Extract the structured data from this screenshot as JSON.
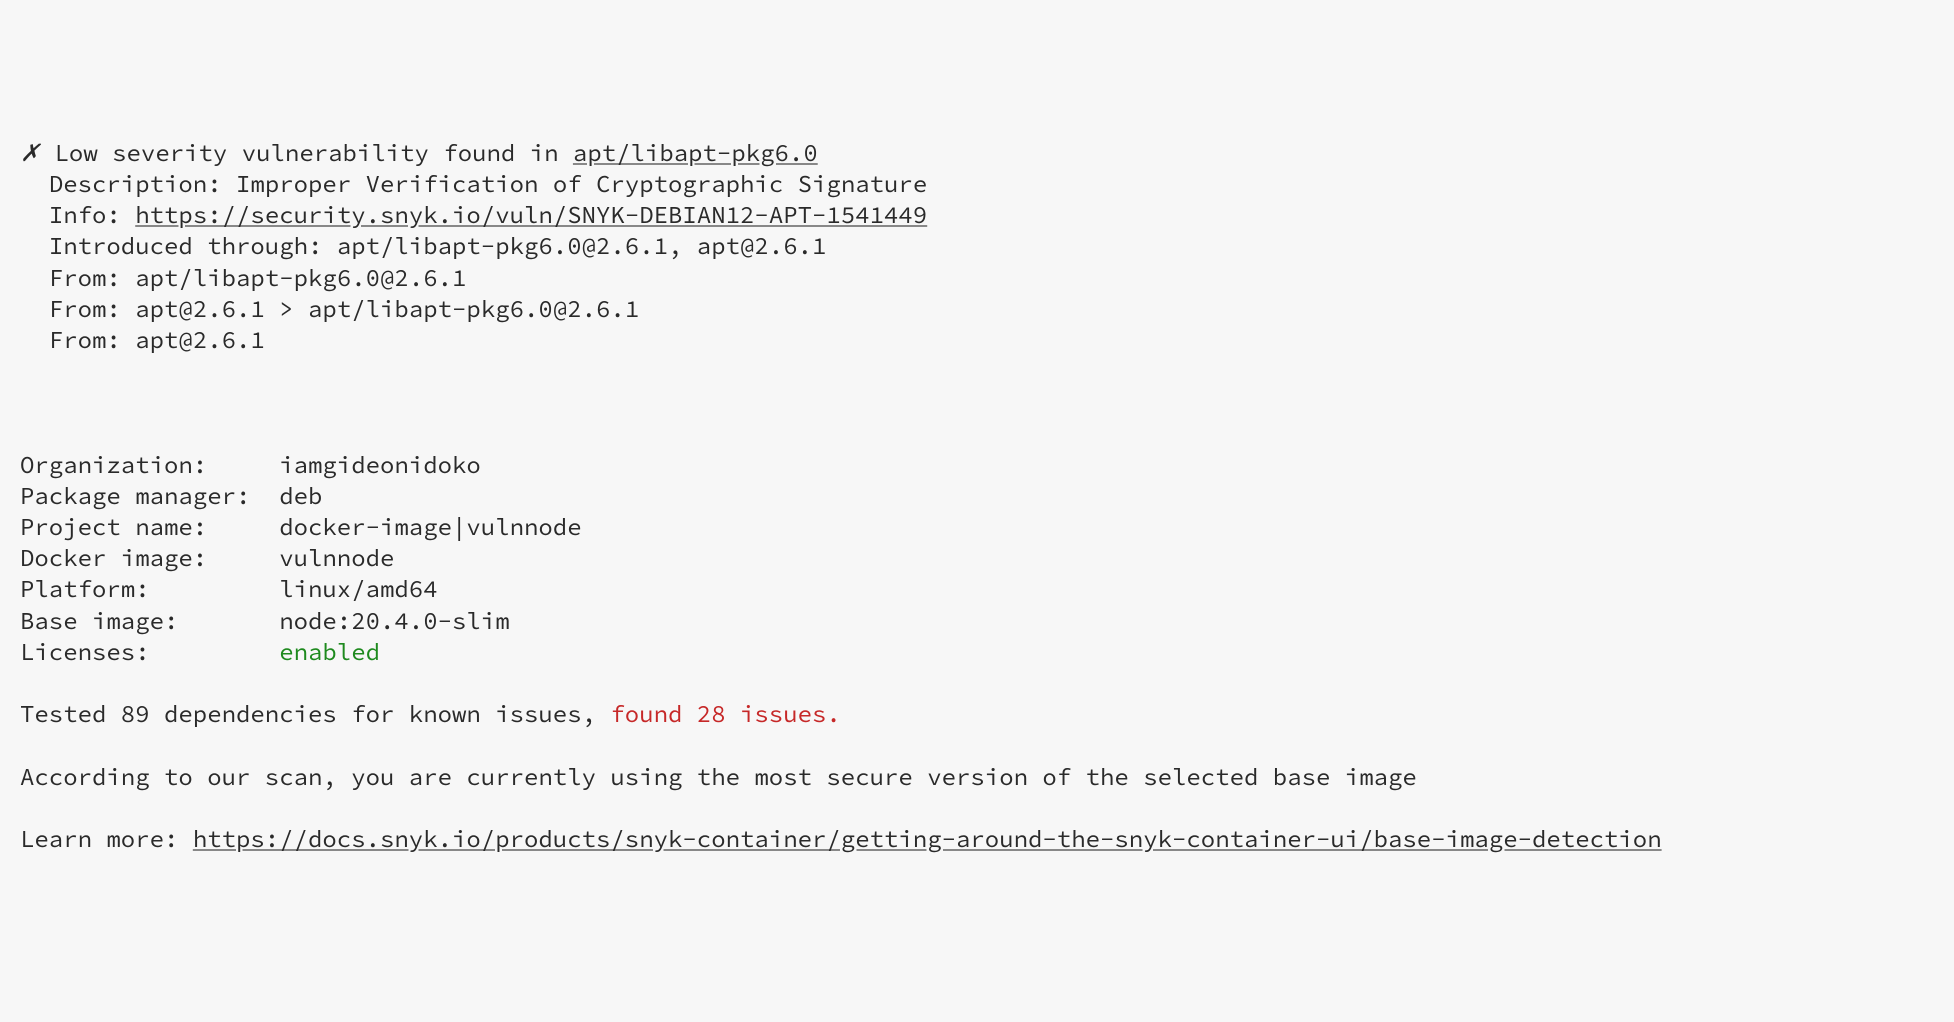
{
  "vulnerability": {
    "marker": "✗",
    "severity_line_prefix": "Low severity vulnerability found in ",
    "package": "apt/libapt-pkg6.0",
    "description_label": "Description: ",
    "description_value": "Improper Verification of Cryptographic Signature",
    "info_label": "Info: ",
    "info_url": "https://security.snyk.io/vuln/SNYK-DEBIAN12-APT-1541449",
    "introduced_label": "Introduced through: ",
    "introduced_value": "apt/libapt-pkg6.0@2.6.1, apt@2.6.1",
    "from1_label": "From: ",
    "from1_value": "apt/libapt-pkg6.0@2.6.1",
    "from2_label": "From: ",
    "from2_value": "apt@2.6.1 > apt/libapt-pkg6.0@2.6.1",
    "from3_label": "From: ",
    "from3_value": "apt@2.6.1"
  },
  "meta": {
    "organization_label": "Organization:     ",
    "organization_value": "iamgideonidoko",
    "package_manager_label": "Package manager:  ",
    "package_manager_value": "deb",
    "project_name_label": "Project name:     ",
    "project_name_value": "docker-image|vulnnode",
    "docker_image_label": "Docker image:     ",
    "docker_image_value": "vulnnode",
    "platform_label": "Platform:         ",
    "platform_value": "linux/amd64",
    "base_image_label": "Base image:       ",
    "base_image_value": "node:20.4.0-slim",
    "licenses_label": "Licenses:         ",
    "licenses_value": "enabled"
  },
  "summary": {
    "tested_prefix": "Tested 89 dependencies for known issues, ",
    "found_issues": "found 28 issues."
  },
  "advice": {
    "secure_line": "According to our scan, you are currently using the most secure version of the selected base image",
    "learn_more_label": "Learn more: ",
    "learn_more_url": "https://docs.snyk.io/products/snyk-container/getting-around-the-snyk-container-ui/base-image-detection"
  }
}
